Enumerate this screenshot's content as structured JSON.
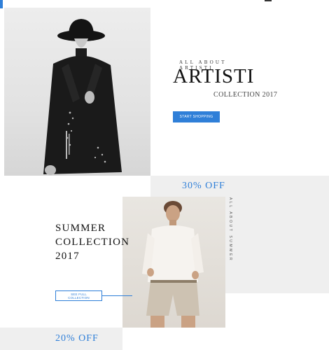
{
  "hero": {
    "kicker": "ALL ABOUT ARTISTI",
    "title": "ARTISTI",
    "subtitle": "COLLECTION 2017",
    "cta_label": "START SHOPPING",
    "image_subject": "man in black hat and coat"
  },
  "summer": {
    "discount": "30% OFF",
    "vertical_kicker": "ALL ABOUT SUMMER",
    "title_lines": [
      "SUMMER",
      "COLLECTION",
      "2017"
    ],
    "cta_label": "SEE FULL COLLECTION",
    "image_subject": "man in white shirt and beige shorts"
  },
  "bottom": {
    "discount": "20% OFF"
  },
  "colors": {
    "accent": "#2f7fd8",
    "panel_grey": "#efefef",
    "text_dark": "#111111"
  }
}
